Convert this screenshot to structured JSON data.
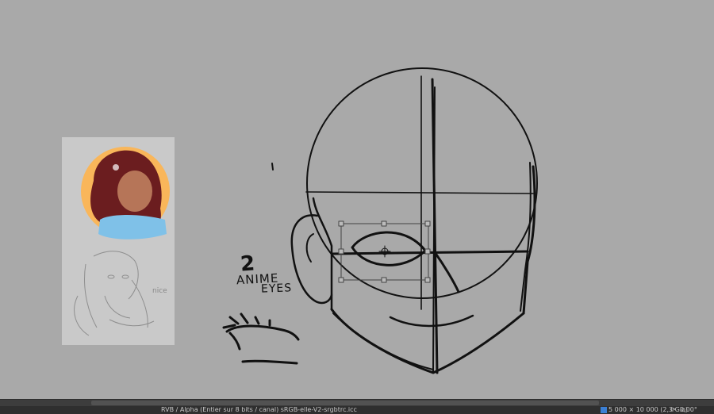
{
  "canvas": {
    "background": "#a9a9a9",
    "annotation_number": "2",
    "annotation_line1": "ANIME",
    "annotation_line2": "EYES",
    "reference_note": "nice"
  },
  "status_bar": {
    "color_info": "RVB / Alpha (Entier sur 8 bits / canal) sRGB-elle-V2-srgbtrc.icc",
    "memory_icon": "memory-icon",
    "image_size": "5 000 × 10 000 (2,3 Gio)",
    "rotation_icon": "rotate-icon",
    "angle": "0,00°"
  }
}
